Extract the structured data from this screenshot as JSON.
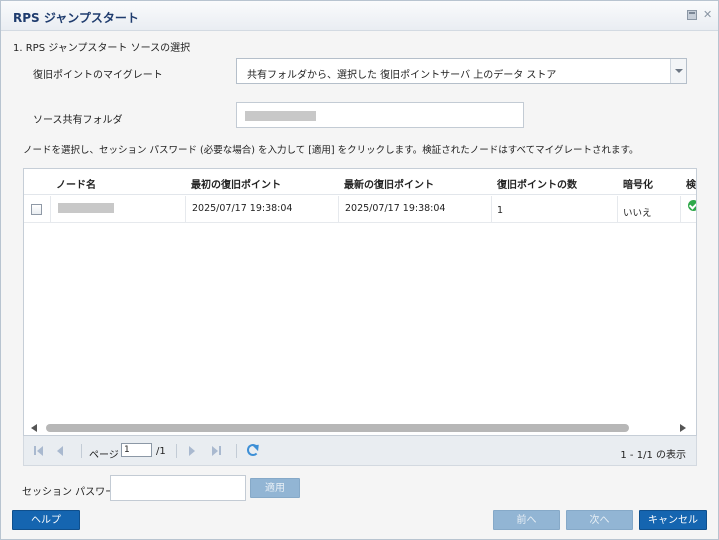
{
  "window": {
    "title": "RPS ジャンプスタート"
  },
  "source": {
    "section_title": "1. RPS ジャンプスタート ソースの選択",
    "migrate_label": "復旧ポイントのマイグレート",
    "migrate_value": "共有フォルダから、選択した 復旧ポイントサーバ 上のデータ ストア",
    "share_label": "ソース共有フォルダ"
  },
  "instruction": "ノードを選択し、セッション パスワード (必要な場合) を入力して [適用] をクリックします。検証されたノードはすべてマイグレートされます。",
  "table": {
    "columns": [
      "ノード名",
      "最初の復旧ポイント",
      "最新の復旧ポイント",
      "復旧ポイントの数",
      "暗号化",
      "検"
    ],
    "rows": [
      {
        "node": "",
        "first": "2025/07/17 19:38:04",
        "latest": "2025/07/17 19:38:04",
        "count": "1",
        "encrypted": "いいえ"
      }
    ]
  },
  "pager": {
    "page_label": "ページ",
    "page_value": "1",
    "total_pages": "/1",
    "summary": "1 - 1/1 の表示"
  },
  "session": {
    "password_label": "セッション パスワード",
    "apply_label": "適用"
  },
  "footer": {
    "help": "ヘルプ",
    "prev": "前へ",
    "next": "次へ",
    "cancel": "キャンセル"
  },
  "colors": {
    "primary_button": "#1565b0",
    "title_text": "#1f3c6e",
    "check_ok": "#2fa84a"
  }
}
